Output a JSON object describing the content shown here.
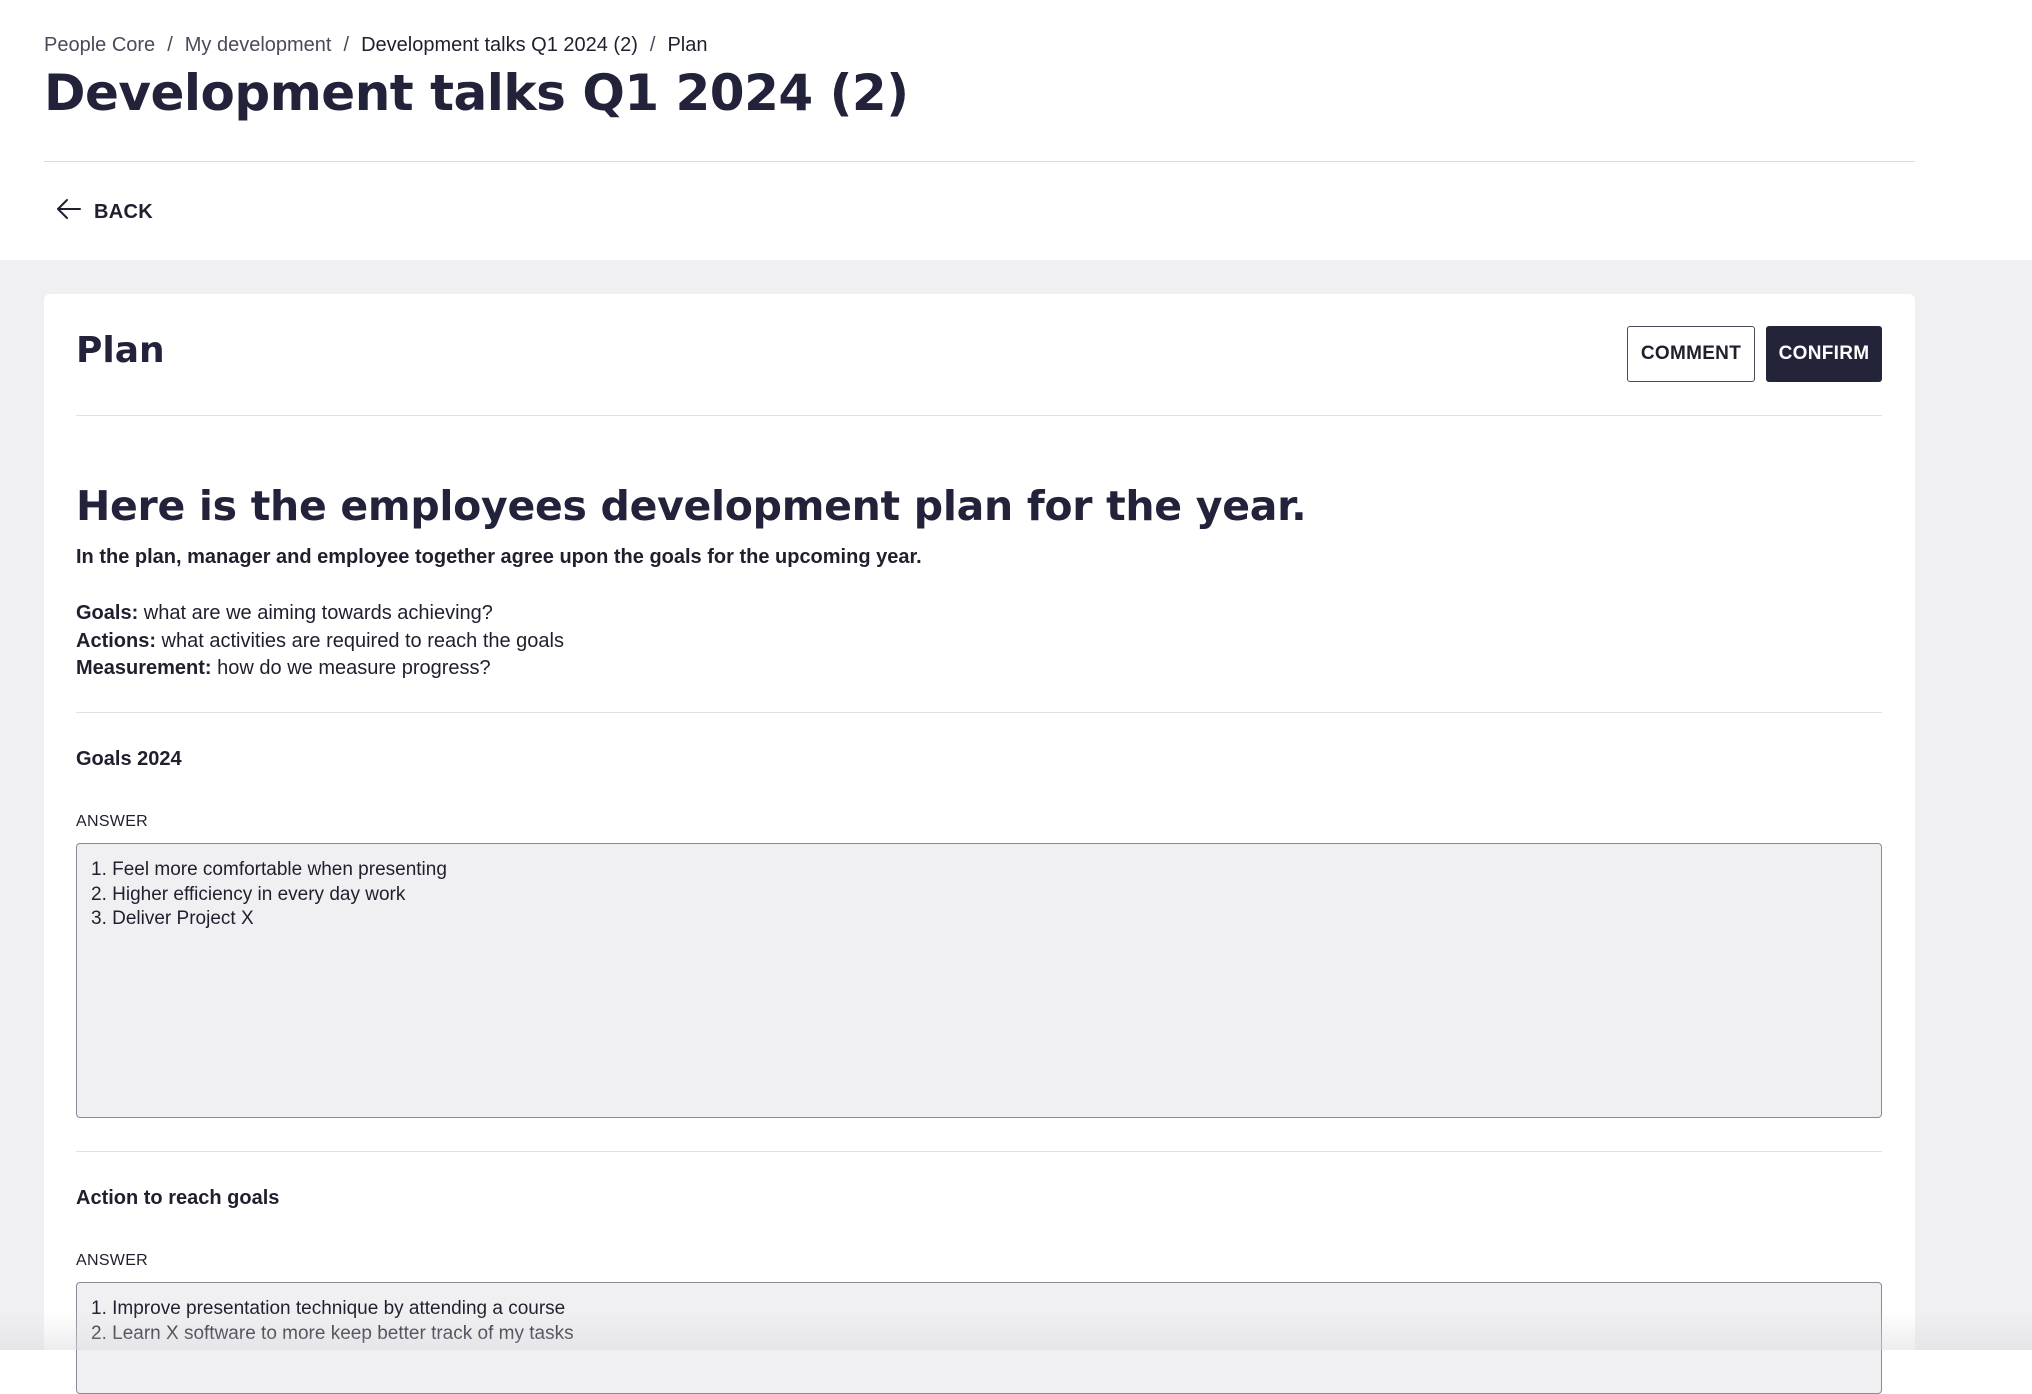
{
  "breadcrumb": {
    "items": [
      "People Core",
      "My development",
      "Development talks Q1 2024 (2)",
      "Plan"
    ],
    "separator": "/"
  },
  "page_title": "Development talks Q1 2024 (2)",
  "back_label": "BACK",
  "card": {
    "title": "Plan",
    "comment_label": "COMMENT",
    "confirm_label": "CONFIRM"
  },
  "intro": {
    "heading": "Here is the employees development plan for the year.",
    "subheading": "In the plan, manager and employee together agree upon the goals for the upcoming year.",
    "definitions": [
      {
        "term": "Goals:",
        "text": " what are we aiming towards achieving?"
      },
      {
        "term": "Actions:",
        "text": " what activities are required to reach the goals"
      },
      {
        "term": "Measurement:",
        "text": " how do we measure progress?"
      }
    ]
  },
  "sections": [
    {
      "title": "Goals 2024",
      "answer_label": "ANSWER",
      "answer_lines": [
        "1. Feel more comfortable when presenting",
        "2. Higher efficiency in every day work",
        "3. Deliver Project X"
      ]
    },
    {
      "title": "Action to reach goals",
      "answer_label": "ANSWER",
      "answer_lines": [
        "1. Improve presentation technique by attending a course",
        "2. Learn X software to more keep better track of my tasks"
      ]
    }
  ],
  "colors": {
    "primary_dark": "#232339",
    "background_gray": "#f0f0f2",
    "text": "#1f1f2e"
  },
  "icons": {
    "back": "arrow-left-icon"
  }
}
